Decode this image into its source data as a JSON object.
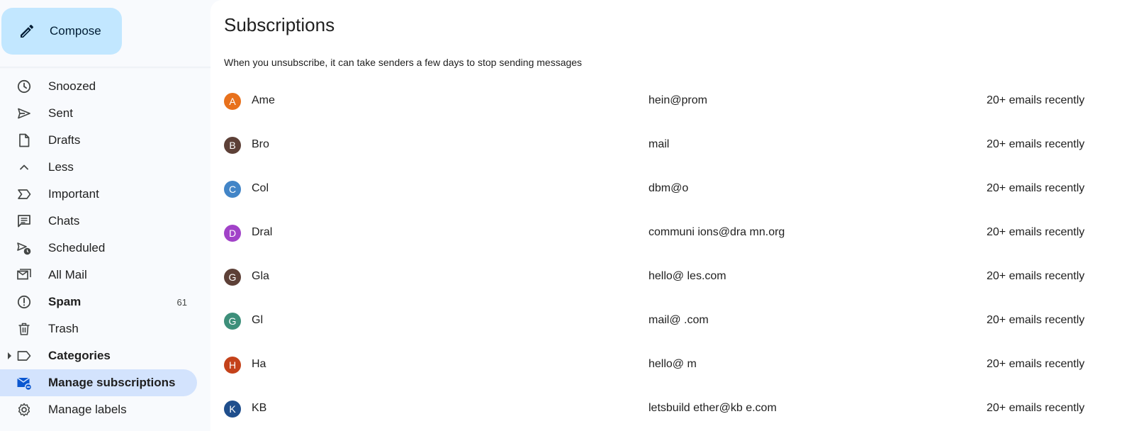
{
  "compose": {
    "label": "Compose",
    "icon": "pencil-icon"
  },
  "nav": [
    {
      "id": "snoozed",
      "label": "Snoozed",
      "icon": "clock-icon"
    },
    {
      "id": "sent",
      "label": "Sent",
      "icon": "send-icon"
    },
    {
      "id": "drafts",
      "label": "Drafts",
      "icon": "file-icon"
    },
    {
      "id": "less",
      "label": "Less",
      "icon": "chevron-up-icon"
    },
    {
      "id": "important",
      "label": "Important",
      "icon": "important-icon"
    },
    {
      "id": "chats",
      "label": "Chats",
      "icon": "chat-icon"
    },
    {
      "id": "scheduled",
      "label": "Scheduled",
      "icon": "scheduled-icon"
    },
    {
      "id": "all-mail",
      "label": "All Mail",
      "icon": "all-mail-icon"
    },
    {
      "id": "spam",
      "label": "Spam",
      "icon": "alert-icon",
      "count": "61",
      "bold": true
    },
    {
      "id": "trash",
      "label": "Trash",
      "icon": "trash-icon"
    },
    {
      "id": "categories",
      "label": "Categories",
      "icon": "label-icon",
      "bold": true,
      "expandable": true
    },
    {
      "id": "manage-subscriptions",
      "label": "Manage subscriptions",
      "icon": "mail-unsubscribe-icon",
      "bold": true,
      "active": true
    },
    {
      "id": "manage-labels",
      "label": "Manage labels",
      "icon": "gear-icon"
    }
  ],
  "main": {
    "title": "Subscriptions",
    "subtitle": "When you unsubscribe, it can take senders a few days to stop sending messages"
  },
  "subscriptions": [
    {
      "initial": "A",
      "color": "#e8711c",
      "sender": "Ame",
      "email": "hein@prom",
      "count": "20+ emails recently"
    },
    {
      "initial": "B",
      "color": "#5d4037",
      "sender": "Bro",
      "email": "mail",
      "count": "20+ emails recently"
    },
    {
      "initial": "C",
      "color": "#4285c7",
      "sender": "Col",
      "email": "dbm@o",
      "count": "20+ emails recently"
    },
    {
      "initial": "D",
      "color": "#a142c8",
      "sender": "Dral",
      "email": "communi  ions@dra   mn.org",
      "count": "20+ emails recently"
    },
    {
      "initial": "G",
      "color": "#5d4037",
      "sender": "Gla",
      "email": "hello@  les.com",
      "count": "20+ emails recently"
    },
    {
      "initial": "G",
      "color": "#3d8f7a",
      "sender": "Gl",
      "email": "mail@  .com",
      "count": "20+ emails recently"
    },
    {
      "initial": "H",
      "color": "#c4421a",
      "sender": "Ha",
      "email": "hello@  m",
      "count": "20+ emails recently"
    },
    {
      "initial": "K",
      "color": "#1f4e8c",
      "sender": "KB",
      "email": "letsbuild  ether@kb   e.com",
      "count": "20+ emails recently"
    }
  ]
}
